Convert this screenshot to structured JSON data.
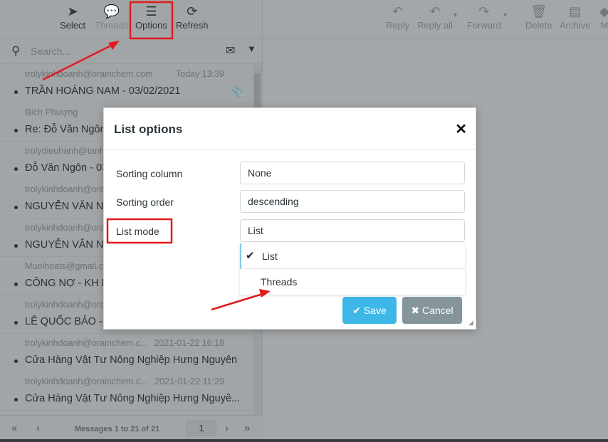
{
  "toolbar": {
    "select": "Select",
    "threads": "Threads",
    "options": "Options",
    "refresh": "Refresh"
  },
  "search": {
    "placeholder": "Search..."
  },
  "messages": [
    {
      "from": "trolykinhdoanh@orainchem.com",
      "date": "Today 13:39",
      "subject": "TRẦN HOÀNG NAM - 03/02/2021",
      "attachment": true
    },
    {
      "from": "Bích Phượng",
      "date": "",
      "subject": "Re: Đỗ Văn Ngôn"
    },
    {
      "from": "trolydieuhanh@tanh",
      "date": "",
      "subject": "Đỗ Văn Ngôn - 03"
    },
    {
      "from": "trolykinhdoanh@ora",
      "date": "",
      "subject": "NGUYỄN VĂN NH"
    },
    {
      "from": "trolykinhdoanh@ora",
      "date": "",
      "subject": "NGUYỄN VĂN NH"
    },
    {
      "from": "Muoihoats@gmail.c",
      "date": "",
      "subject": "CÔNG NỢ - KH MU"
    },
    {
      "from": "trolykinhdoanh@ora",
      "date": "",
      "subject": "LÊ QUỐC BẢO - 27"
    },
    {
      "from": "trolykinhdoanh@orainchem.c...",
      "date": "2021-01-22 16:18",
      "subject": "Cửa Hàng Vật Tư Nông Nghiệp Hưng Nguyên"
    },
    {
      "from": "trolykinhdoanh@orainchem.c...",
      "date": "2021-01-22 11:29",
      "subject": "Cửa Hàng Vật Tư Nông Nghiệp Hưng Nguyê..."
    }
  ],
  "footer": {
    "count": "Messages 1 to 21 of 21",
    "page": "1"
  },
  "right_toolbar": {
    "reply": "Reply",
    "reply_all": "Reply all",
    "forward": "Forward",
    "delete": "Delete",
    "archive": "Archive",
    "more": "M"
  },
  "dialog": {
    "title": "List options",
    "sorting_column_label": "Sorting column",
    "sorting_column_value": "None",
    "sorting_order_label": "Sorting order",
    "sorting_order_value": "descending",
    "list_mode_label": "List mode",
    "list_mode_value": "List",
    "options": [
      "List",
      "Threads"
    ],
    "save": "Save",
    "cancel": "Cancel"
  },
  "colors": {
    "accent": "#3eb7e8",
    "annotation": "#e21a1a"
  }
}
